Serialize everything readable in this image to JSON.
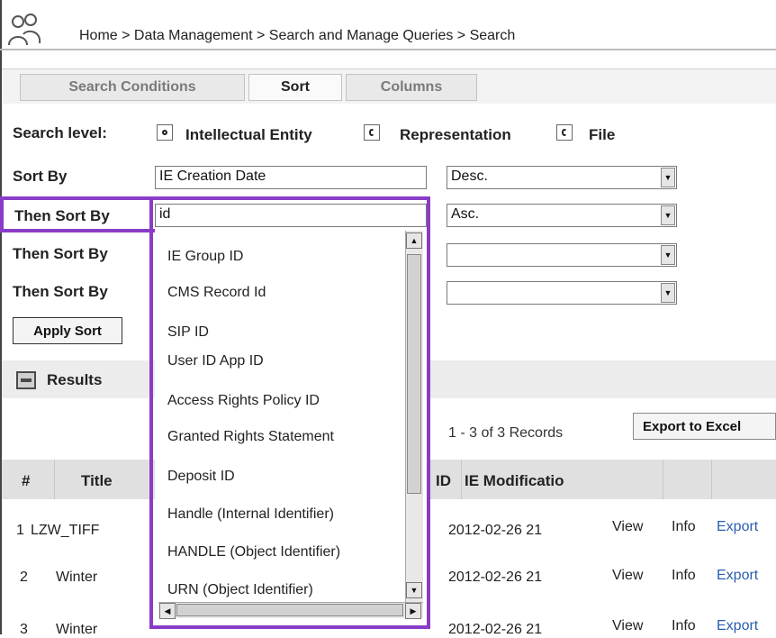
{
  "breadcrumb": "Home > Data Management > Search and Manage Queries > Search",
  "tabs": [
    {
      "label": "Search Conditions"
    },
    {
      "label": "Sort"
    },
    {
      "label": "Columns"
    }
  ],
  "search_level": {
    "label": "Search level:",
    "options": [
      {
        "label": "Intellectual Entity",
        "selected": true
      },
      {
        "label": "Representation",
        "selected": false
      },
      {
        "label": "File",
        "selected": false
      }
    ]
  },
  "sort": {
    "sort_by_label": "Sort By",
    "then_sort_by_label": "Then Sort By",
    "rows": [
      {
        "field": "IE Creation Date",
        "order": "Desc."
      },
      {
        "field": "id",
        "order": "Asc."
      },
      {
        "field": "",
        "order": ""
      },
      {
        "field": "",
        "order": ""
      }
    ],
    "apply_label": "Apply Sort"
  },
  "dropdown_options": [
    "IE Group ID",
    "CMS Record Id",
    "SIP ID",
    "User ID App ID",
    "Access Rights Policy ID",
    "Granted Rights Statement",
    "Deposit ID",
    "Handle (Internal Identifier)",
    "HANDLE (Object Identifier)",
    "URN (Object Identifier)"
  ],
  "results": {
    "label": "Results",
    "records_text": "1 - 3 of 3 Records",
    "export_excel_label": "Export to Excel",
    "columns": {
      "num": "#",
      "title": "Title",
      "id_partial": "ID",
      "ie_mod": "IE Modificatio"
    },
    "rows": [
      {
        "num": "1",
        "title": "LZW_TIFF",
        "date": "2012-02-26 21",
        "view": "View",
        "info": "Info",
        "export": "Export"
      },
      {
        "num": "2",
        "title": "Winter",
        "date": "2012-02-26 21",
        "view": "View",
        "info": "Info",
        "export": "Export"
      },
      {
        "num": "3",
        "title": "Winter",
        "date": "2012-02-26 21",
        "view": "View",
        "info": "Info",
        "export": "Export"
      }
    ]
  },
  "colors": {
    "highlight": "#8a3cc8",
    "link": "#2a5db0"
  }
}
